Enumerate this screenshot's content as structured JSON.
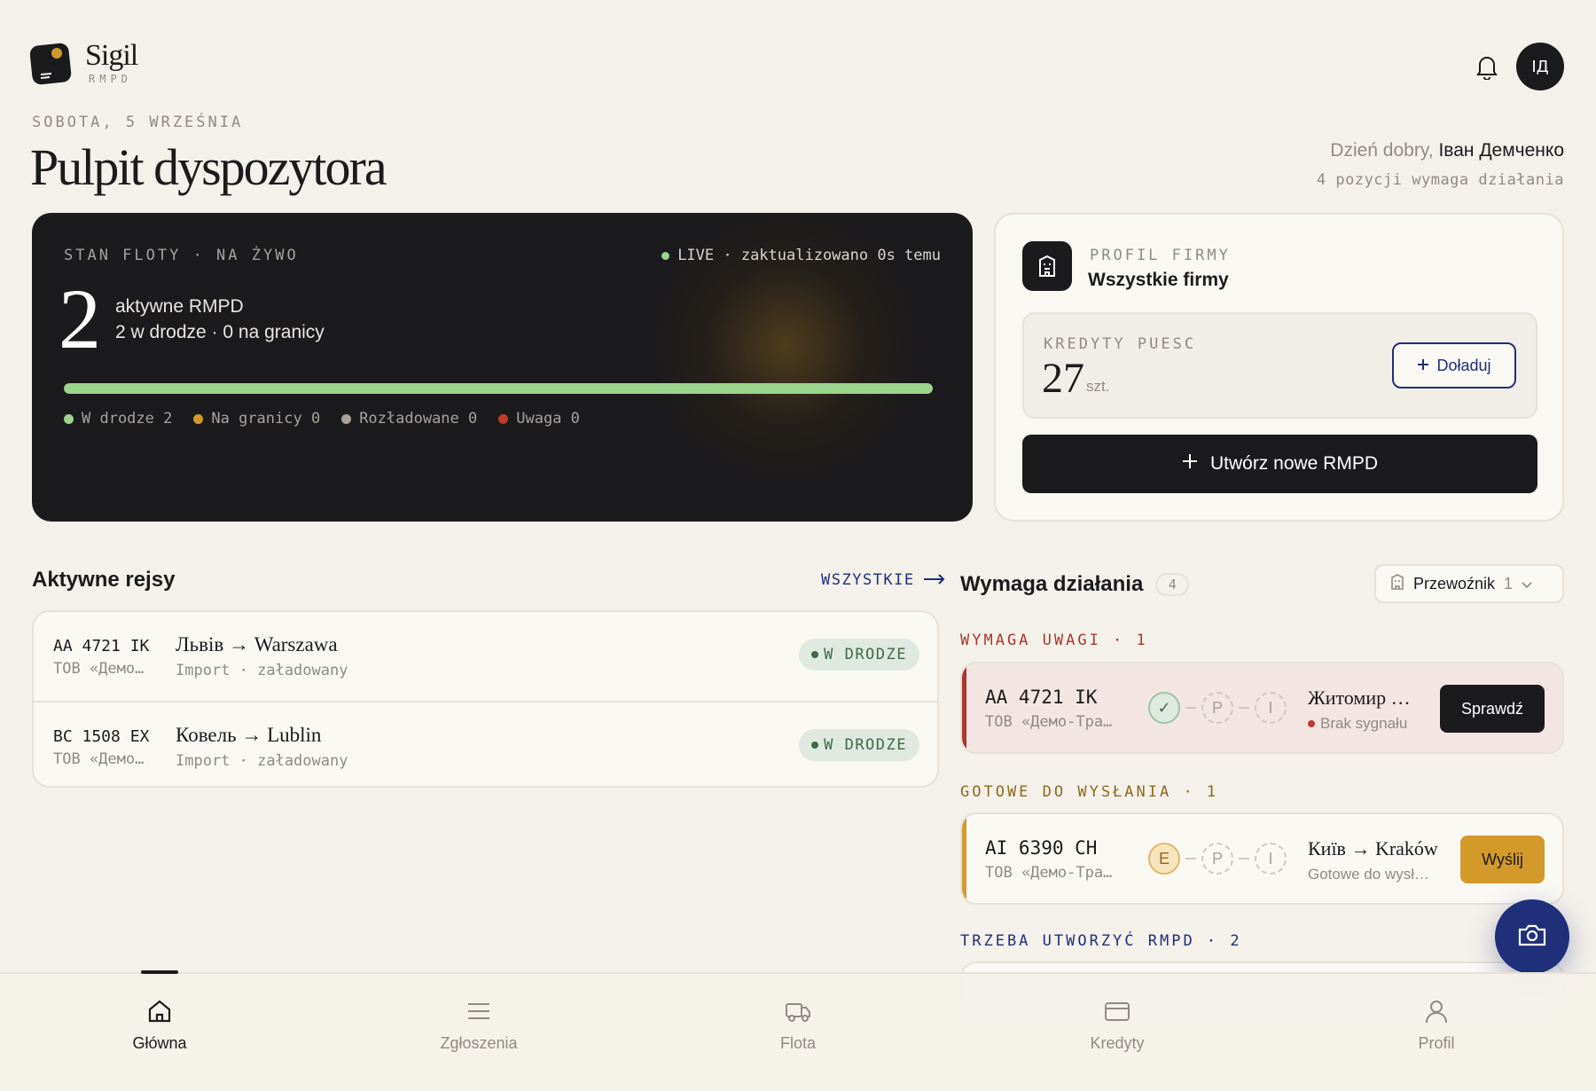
{
  "app": {
    "name": "Sigil",
    "subtitle": "RMPD"
  },
  "header": {
    "user_initials": "ІД",
    "date": "SOBOTA, 5 WRZEŚNIA",
    "title": "Pulpit dyspozytora",
    "greeting_prefix": "Dzień dobry,",
    "user_name": "Іван Демченко",
    "actions_hint": "4 pozycji wymaga działania"
  },
  "fleet": {
    "label": "STAN FLOTY · NA ŻYWO",
    "live_text": "LIVE · zaktualizowano 0s temu",
    "active_count": "2",
    "active_label": "aktywne RMPD",
    "breakdown": "2 w drodze · 0 na granicy",
    "progress_fraction": 1.0,
    "legend": [
      {
        "label": "W drodze 2",
        "color": "#9bd58d"
      },
      {
        "label": "Na granicy 0",
        "color": "#d39a2b"
      },
      {
        "label": "Rozładowane 0",
        "color": "#a6a29b"
      },
      {
        "label": "Uwaga 0",
        "color": "#c0392b"
      }
    ]
  },
  "company": {
    "label": "PROFIL FIRMY",
    "name": "Wszystkie firmy",
    "credits_label": "KREDYTY PUESC",
    "credits_value": "27",
    "credits_unit": "szt.",
    "topup_label": "Doładuj",
    "create_label": "Utwórz nowe RMPD"
  },
  "trips": {
    "title": "Aktywne rejsy",
    "all_label": "WSZYSTKIE",
    "rows": [
      {
        "plate": "AA 4721 IK",
        "company": "ТОВ «Демо…",
        "route": "Львів → Warszawa",
        "meta": "Import · załadowany",
        "status": "W DRODZE"
      },
      {
        "plate": "BC 1508 EX",
        "company": "ТОВ «Демо…",
        "route": "Ковель → Lublin",
        "meta": "Import · załadowany",
        "status": "W DRODZE"
      }
    ]
  },
  "actions": {
    "title": "Wymaga działania",
    "count": "4",
    "carrier_label": "Przewoźnik",
    "carrier_count": "1",
    "groups": [
      {
        "label": "WYMAGA UWAGI · 1",
        "color": "#a8372e",
        "item": {
          "plate": "AA 4721 IK",
          "company": "ТОВ «Демо-Тра…",
          "steps": [
            "✓",
            "P",
            "I"
          ],
          "dest": "Житомир …",
          "note": "Brak sygnału",
          "button": "Sprawdź"
        }
      },
      {
        "label": "GOTOWE DO WYSŁANIA · 1",
        "color": "#8a6a1c",
        "item": {
          "plate": "AI 6390 CH",
          "company": "ТОВ «Демо-Тра…",
          "steps": [
            "E",
            "P",
            "I"
          ],
          "dest": "Київ → Kraków",
          "note": "Gotowe do wysł…",
          "button": "Wyślij"
        }
      },
      {
        "label": "TRZEBA UTWORZYĆ RMPD · 2",
        "color": "#1f2f7a"
      }
    ]
  },
  "nav": [
    {
      "label": "Główna",
      "icon": "home-icon"
    },
    {
      "label": "Zgłoszenia",
      "icon": "list-icon"
    },
    {
      "label": "Flota",
      "icon": "truck-icon"
    },
    {
      "label": "Kredyty",
      "icon": "card-icon"
    },
    {
      "label": "Profil",
      "icon": "user-icon"
    }
  ]
}
